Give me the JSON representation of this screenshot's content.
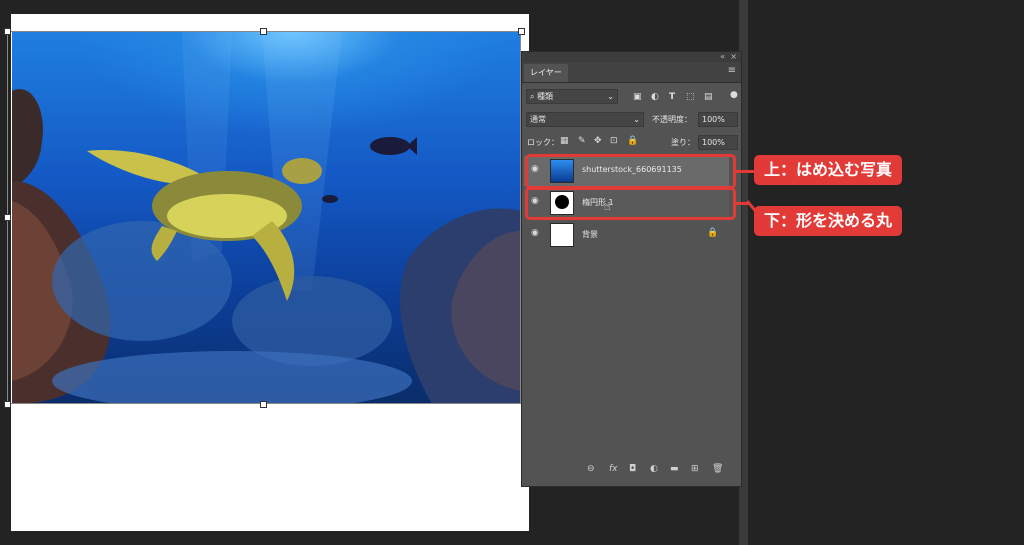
{
  "panel": {
    "tab_label": "レイヤー",
    "collapse_glyph": "«",
    "close_glyph": "×",
    "filter": {
      "kind_label": "種類",
      "kind_icon": "search-icon"
    },
    "filter_icons": [
      "pixel-filter-icon",
      "adjustment-filter-icon",
      "type-filter-icon",
      "shape-filter-icon",
      "smart-object-filter-icon"
    ],
    "blend_mode": "通常",
    "opacity_label": "不透明度：",
    "opacity_value": "100%",
    "lock_label": "ロック：",
    "fill_label": "塗り：",
    "fill_value": "100%",
    "layers": [
      {
        "name": "shutterstock_660691135",
        "kind": "photo",
        "visible": true
      },
      {
        "name": "楕円形 1",
        "kind": "shape",
        "visible": true
      },
      {
        "name": "背景",
        "kind": "background",
        "visible": true,
        "locked": true
      }
    ],
    "bottom_icons": [
      "link-icon",
      "fx-icon",
      "mask-icon",
      "adjustment-icon",
      "group-folder-icon",
      "new-layer-icon",
      "trash-icon"
    ],
    "bottom_glyphs": [
      "⊖",
      "fx",
      "◘",
      "◐",
      "▬",
      "⊞",
      "🗑"
    ]
  },
  "callouts": {
    "top": "上：はめ込む写真",
    "bottom": "下：形を決める丸"
  },
  "colors": {
    "accent_red": "#e23a36",
    "panel_bg": "#535353",
    "app_bg": "#232323"
  }
}
